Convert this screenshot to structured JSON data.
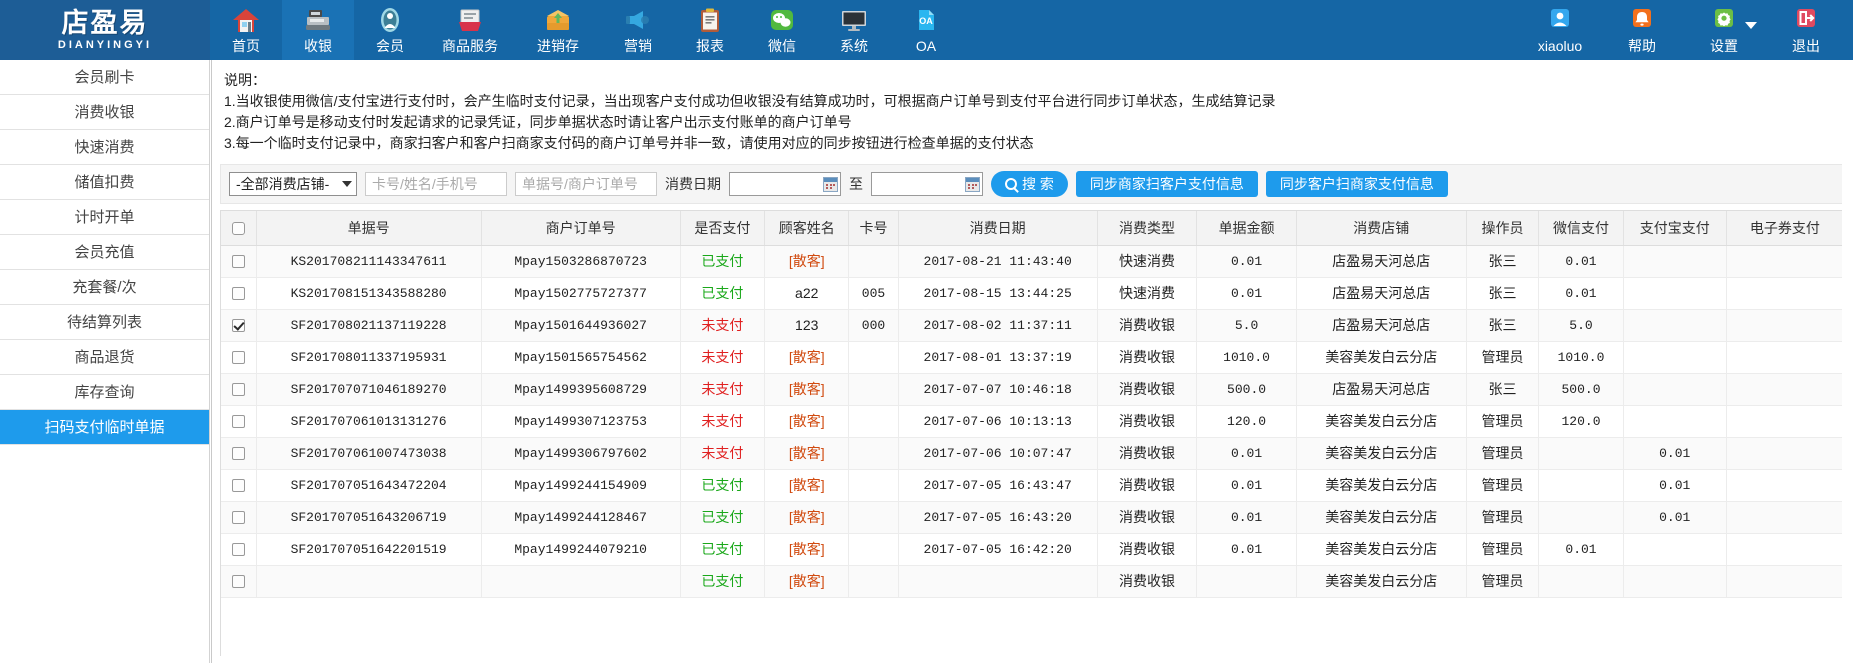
{
  "brand": {
    "name": "店盈易",
    "pinyin": "DIANYINGYI"
  },
  "topnav": {
    "items": [
      {
        "label": "首页",
        "icon": "home-icon",
        "active": false
      },
      {
        "label": "收银",
        "icon": "cash-register-icon",
        "active": true
      },
      {
        "label": "会员",
        "icon": "member-icon",
        "active": false
      },
      {
        "label": "商品服务",
        "icon": "goods-service-icon",
        "active": false
      },
      {
        "label": "进销存",
        "icon": "inventory-icon",
        "active": false
      },
      {
        "label": "营销",
        "icon": "megaphone-icon",
        "active": false
      },
      {
        "label": "报表",
        "icon": "report-clipboard-icon",
        "active": false
      },
      {
        "label": "微信",
        "icon": "wechat-icon",
        "active": false
      },
      {
        "label": "系统",
        "icon": "monitor-icon",
        "active": false
      },
      {
        "label": "OA",
        "icon": "oa-icon",
        "active": false
      }
    ],
    "right": [
      {
        "label": "xiaoluo",
        "icon": "user-avatar-icon"
      },
      {
        "label": "帮助",
        "icon": "bell-help-icon"
      },
      {
        "label": "设置",
        "icon": "gear-icon",
        "caret": true
      },
      {
        "label": "退出",
        "icon": "logout-icon"
      }
    ]
  },
  "sidebar": {
    "items": [
      {
        "label": "会员刷卡",
        "active": false
      },
      {
        "label": "消费收银",
        "active": false
      },
      {
        "label": "快速消费",
        "active": false
      },
      {
        "label": "储值扣费",
        "active": false
      },
      {
        "label": "计时开单",
        "active": false
      },
      {
        "label": "会员充值",
        "active": false
      },
      {
        "label": "充套餐/次",
        "active": false
      },
      {
        "label": "待结算列表",
        "active": false
      },
      {
        "label": "商品退货",
        "active": false
      },
      {
        "label": "库存查询",
        "active": false
      },
      {
        "label": "扫码支付临时单据",
        "active": true
      }
    ]
  },
  "notes": {
    "title": "说明：",
    "lines": [
      "1.当收银使用微信/支付宝进行支付时，会产生临时支付记录，当出现客户支付成功但收银没有结算成功时，可根据商户订单号到支付平台进行同步订单状态，生成结算记录",
      "2.商户订单号是移动支付时发起请求的记录凭证，同步单据状态时请让客户出示支付账单的商户订单号",
      "3.每一个临时支付记录中，商家扫客户和客户扫商家支付码的商户订单号并非一致，请使用对应的同步按钮进行检查单据的支付状态"
    ]
  },
  "filter": {
    "shop_select": "-全部消费店铺-",
    "card_placeholder": "卡号/姓名/手机号",
    "order_placeholder": "单据号/商户订单号",
    "date_label": "消费日期",
    "date_from": "",
    "date_to": "",
    "date_separator": "至",
    "search_label": "搜 索",
    "sync_merchant_scan_label": "同步商家扫客户支付信息",
    "sync_customer_scan_label": "同步客户扫商家支付信息"
  },
  "table": {
    "columns": [
      "单据号",
      "商户订单号",
      "是否支付",
      "顾客姓名",
      "卡号",
      "消费日期",
      "消费类型",
      "单据金额",
      "消费店铺",
      "操作员",
      "微信支付",
      "支付宝支付",
      "电子券支付"
    ],
    "rows": [
      {
        "checked": false,
        "bill_no": "KS201708211143347611",
        "merchant_order": "Mpay1503286870723",
        "paid_status": "已支付",
        "paid": true,
        "customer": "[散客]",
        "card_no": "",
        "date": "2017-08-21 11:43:40",
        "type": "快速消费",
        "amount": "0.01",
        "shop": "店盈易天河总店",
        "operator": "张三",
        "wechat": "0.01",
        "alipay": "",
        "voucher": ""
      },
      {
        "checked": false,
        "bill_no": "KS201708151343588280",
        "merchant_order": "Mpay1502775727377",
        "paid_status": "已支付",
        "paid": true,
        "customer": "a22",
        "card_no": "005",
        "date": "2017-08-15 13:44:25",
        "type": "快速消费",
        "amount": "0.01",
        "shop": "店盈易天河总店",
        "operator": "张三",
        "wechat": "0.01",
        "alipay": "",
        "voucher": ""
      },
      {
        "checked": true,
        "bill_no": "SF201708021137119228",
        "merchant_order": "Mpay1501644936027",
        "paid_status": "未支付",
        "paid": false,
        "customer": "123",
        "card_no": "000",
        "date": "2017-08-02 11:37:11",
        "type": "消费收银",
        "amount": "5.0",
        "shop": "店盈易天河总店",
        "operator": "张三",
        "wechat": "5.0",
        "alipay": "",
        "voucher": ""
      },
      {
        "checked": false,
        "bill_no": "SF201708011337195931",
        "merchant_order": "Mpay1501565754562",
        "paid_status": "未支付",
        "paid": false,
        "customer": "[散客]",
        "card_no": "",
        "date": "2017-08-01 13:37:19",
        "type": "消费收银",
        "amount": "1010.0",
        "shop": "美容美发白云分店",
        "operator": "管理员",
        "wechat": "1010.0",
        "alipay": "",
        "voucher": ""
      },
      {
        "checked": false,
        "bill_no": "SF201707071046189270",
        "merchant_order": "Mpay1499395608729",
        "paid_status": "未支付",
        "paid": false,
        "customer": "[散客]",
        "card_no": "",
        "date": "2017-07-07 10:46:18",
        "type": "消费收银",
        "amount": "500.0",
        "shop": "店盈易天河总店",
        "operator": "张三",
        "wechat": "500.0",
        "alipay": "",
        "voucher": ""
      },
      {
        "checked": false,
        "bill_no": "SF201707061013131276",
        "merchant_order": "Mpay1499307123753",
        "paid_status": "未支付",
        "paid": false,
        "customer": "[散客]",
        "card_no": "",
        "date": "2017-07-06 10:13:13",
        "type": "消费收银",
        "amount": "120.0",
        "shop": "美容美发白云分店",
        "operator": "管理员",
        "wechat": "120.0",
        "alipay": "",
        "voucher": ""
      },
      {
        "checked": false,
        "bill_no": "SF201707061007473038",
        "merchant_order": "Mpay1499306797602",
        "paid_status": "未支付",
        "paid": false,
        "customer": "[散客]",
        "card_no": "",
        "date": "2017-07-06 10:07:47",
        "type": "消费收银",
        "amount": "0.01",
        "shop": "美容美发白云分店",
        "operator": "管理员",
        "wechat": "",
        "alipay": "0.01",
        "voucher": ""
      },
      {
        "checked": false,
        "bill_no": "SF201707051643472204",
        "merchant_order": "Mpay1499244154909",
        "paid_status": "已支付",
        "paid": true,
        "customer": "[散客]",
        "card_no": "",
        "date": "2017-07-05 16:43:47",
        "type": "消费收银",
        "amount": "0.01",
        "shop": "美容美发白云分店",
        "operator": "管理员",
        "wechat": "",
        "alipay": "0.01",
        "voucher": ""
      },
      {
        "checked": false,
        "bill_no": "SF201707051643206719",
        "merchant_order": "Mpay1499244128467",
        "paid_status": "已支付",
        "paid": true,
        "customer": "[散客]",
        "card_no": "",
        "date": "2017-07-05 16:43:20",
        "type": "消费收银",
        "amount": "0.01",
        "shop": "美容美发白云分店",
        "operator": "管理员",
        "wechat": "",
        "alipay": "0.01",
        "voucher": ""
      },
      {
        "checked": false,
        "bill_no": "SF201707051642201519",
        "merchant_order": "Mpay1499244079210",
        "paid_status": "已支付",
        "paid": true,
        "customer": "[散客]",
        "card_no": "",
        "date": "2017-07-05 16:42:20",
        "type": "消费收银",
        "amount": "0.01",
        "shop": "美容美发白云分店",
        "operator": "管理员",
        "wechat": "0.01",
        "alipay": "",
        "voucher": ""
      },
      {
        "checked": false,
        "bill_no": "",
        "merchant_order": "",
        "paid_status": "已支付",
        "paid": true,
        "customer": "[散客]",
        "card_no": "",
        "date": "",
        "type": "消费收银",
        "amount": "",
        "shop": "美容美发白云分店",
        "operator": "管理员",
        "wechat": "",
        "alipay": "",
        "voucher": ""
      }
    ]
  },
  "colors": {
    "brand_blue": "#1566a5",
    "accent_blue": "#1e9bec",
    "active_nav": "#1a72b5",
    "paid_green": "#1aa81a",
    "unpaid_red": "#e02020",
    "guest_orange": "#d14b10"
  }
}
